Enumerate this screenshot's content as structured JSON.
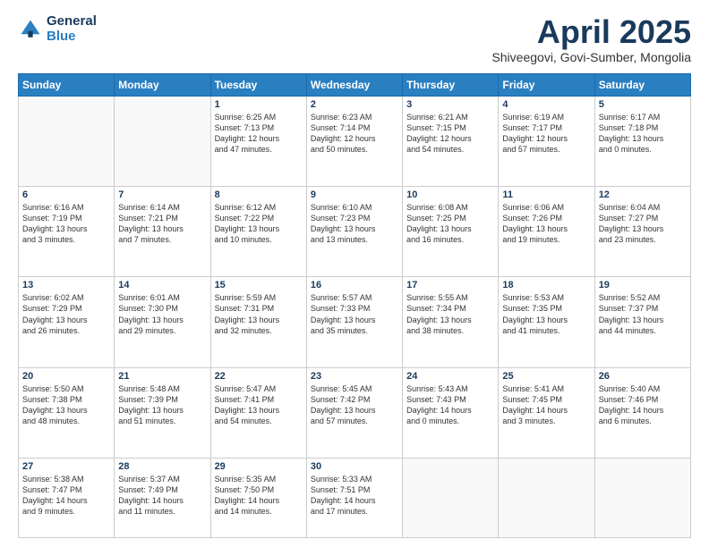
{
  "logo": {
    "general": "General",
    "blue": "Blue"
  },
  "header": {
    "title": "April 2025",
    "subtitle": "Shiveegovi, Govi-Sumber, Mongolia"
  },
  "days_of_week": [
    "Sunday",
    "Monday",
    "Tuesday",
    "Wednesday",
    "Thursday",
    "Friday",
    "Saturday"
  ],
  "weeks": [
    [
      {
        "day": "",
        "content": ""
      },
      {
        "day": "",
        "content": ""
      },
      {
        "day": "1",
        "content": "Sunrise: 6:25 AM\nSunset: 7:13 PM\nDaylight: 12 hours\nand 47 minutes."
      },
      {
        "day": "2",
        "content": "Sunrise: 6:23 AM\nSunset: 7:14 PM\nDaylight: 12 hours\nand 50 minutes."
      },
      {
        "day": "3",
        "content": "Sunrise: 6:21 AM\nSunset: 7:15 PM\nDaylight: 12 hours\nand 54 minutes."
      },
      {
        "day": "4",
        "content": "Sunrise: 6:19 AM\nSunset: 7:17 PM\nDaylight: 12 hours\nand 57 minutes."
      },
      {
        "day": "5",
        "content": "Sunrise: 6:17 AM\nSunset: 7:18 PM\nDaylight: 13 hours\nand 0 minutes."
      }
    ],
    [
      {
        "day": "6",
        "content": "Sunrise: 6:16 AM\nSunset: 7:19 PM\nDaylight: 13 hours\nand 3 minutes."
      },
      {
        "day": "7",
        "content": "Sunrise: 6:14 AM\nSunset: 7:21 PM\nDaylight: 13 hours\nand 7 minutes."
      },
      {
        "day": "8",
        "content": "Sunrise: 6:12 AM\nSunset: 7:22 PM\nDaylight: 13 hours\nand 10 minutes."
      },
      {
        "day": "9",
        "content": "Sunrise: 6:10 AM\nSunset: 7:23 PM\nDaylight: 13 hours\nand 13 minutes."
      },
      {
        "day": "10",
        "content": "Sunrise: 6:08 AM\nSunset: 7:25 PM\nDaylight: 13 hours\nand 16 minutes."
      },
      {
        "day": "11",
        "content": "Sunrise: 6:06 AM\nSunset: 7:26 PM\nDaylight: 13 hours\nand 19 minutes."
      },
      {
        "day": "12",
        "content": "Sunrise: 6:04 AM\nSunset: 7:27 PM\nDaylight: 13 hours\nand 23 minutes."
      }
    ],
    [
      {
        "day": "13",
        "content": "Sunrise: 6:02 AM\nSunset: 7:29 PM\nDaylight: 13 hours\nand 26 minutes."
      },
      {
        "day": "14",
        "content": "Sunrise: 6:01 AM\nSunset: 7:30 PM\nDaylight: 13 hours\nand 29 minutes."
      },
      {
        "day": "15",
        "content": "Sunrise: 5:59 AM\nSunset: 7:31 PM\nDaylight: 13 hours\nand 32 minutes."
      },
      {
        "day": "16",
        "content": "Sunrise: 5:57 AM\nSunset: 7:33 PM\nDaylight: 13 hours\nand 35 minutes."
      },
      {
        "day": "17",
        "content": "Sunrise: 5:55 AM\nSunset: 7:34 PM\nDaylight: 13 hours\nand 38 minutes."
      },
      {
        "day": "18",
        "content": "Sunrise: 5:53 AM\nSunset: 7:35 PM\nDaylight: 13 hours\nand 41 minutes."
      },
      {
        "day": "19",
        "content": "Sunrise: 5:52 AM\nSunset: 7:37 PM\nDaylight: 13 hours\nand 44 minutes."
      }
    ],
    [
      {
        "day": "20",
        "content": "Sunrise: 5:50 AM\nSunset: 7:38 PM\nDaylight: 13 hours\nand 48 minutes."
      },
      {
        "day": "21",
        "content": "Sunrise: 5:48 AM\nSunset: 7:39 PM\nDaylight: 13 hours\nand 51 minutes."
      },
      {
        "day": "22",
        "content": "Sunrise: 5:47 AM\nSunset: 7:41 PM\nDaylight: 13 hours\nand 54 minutes."
      },
      {
        "day": "23",
        "content": "Sunrise: 5:45 AM\nSunset: 7:42 PM\nDaylight: 13 hours\nand 57 minutes."
      },
      {
        "day": "24",
        "content": "Sunrise: 5:43 AM\nSunset: 7:43 PM\nDaylight: 14 hours\nand 0 minutes."
      },
      {
        "day": "25",
        "content": "Sunrise: 5:41 AM\nSunset: 7:45 PM\nDaylight: 14 hours\nand 3 minutes."
      },
      {
        "day": "26",
        "content": "Sunrise: 5:40 AM\nSunset: 7:46 PM\nDaylight: 14 hours\nand 6 minutes."
      }
    ],
    [
      {
        "day": "27",
        "content": "Sunrise: 5:38 AM\nSunset: 7:47 PM\nDaylight: 14 hours\nand 9 minutes."
      },
      {
        "day": "28",
        "content": "Sunrise: 5:37 AM\nSunset: 7:49 PM\nDaylight: 14 hours\nand 11 minutes."
      },
      {
        "day": "29",
        "content": "Sunrise: 5:35 AM\nSunset: 7:50 PM\nDaylight: 14 hours\nand 14 minutes."
      },
      {
        "day": "30",
        "content": "Sunrise: 5:33 AM\nSunset: 7:51 PM\nDaylight: 14 hours\nand 17 minutes."
      },
      {
        "day": "",
        "content": ""
      },
      {
        "day": "",
        "content": ""
      },
      {
        "day": "",
        "content": ""
      }
    ]
  ]
}
